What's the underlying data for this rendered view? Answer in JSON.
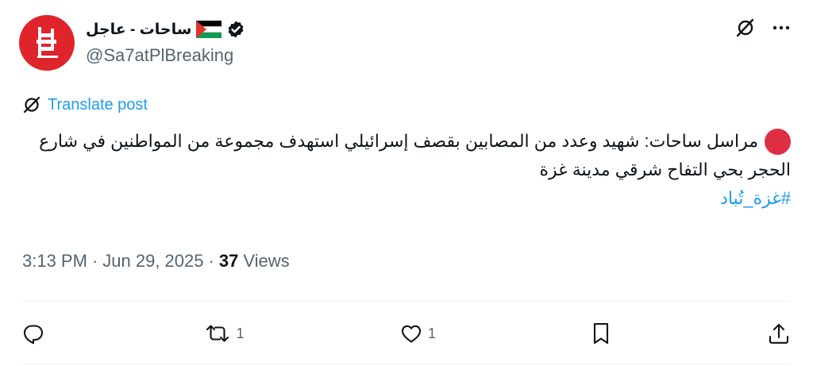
{
  "author": {
    "display_name": "ساحات - عاجل",
    "handle": "@Sa7atPlBreaking",
    "flag_icon": "palestine-flag-icon",
    "verified_icon": "verified-badge-icon",
    "avatar_icon": "sa7at-logo"
  },
  "translate": {
    "label": "Translate post"
  },
  "post": {
    "lead_icon": "red-circle-emoji",
    "line1": "مراسل ساحات: شهيد وعدد من المصابين بقصف إسرائيلي استهدف مجموعة من المواطنين في شارع",
    "line2": "الحجر بحي التفاح شرقي مدينة غزة",
    "hashtag": "#غزة_تُباد"
  },
  "meta": {
    "time": "3:13 PM",
    "separator": "·",
    "date": "Jun 29, 2025",
    "views_count": "37",
    "views_label": "Views"
  },
  "actions": {
    "reply_count": "",
    "repost_count": "1",
    "like_count": "1"
  },
  "colors": {
    "accent": "#1d9bf0",
    "muted": "#536471",
    "brand_red": "#e0242c",
    "text": "#0f1419"
  }
}
